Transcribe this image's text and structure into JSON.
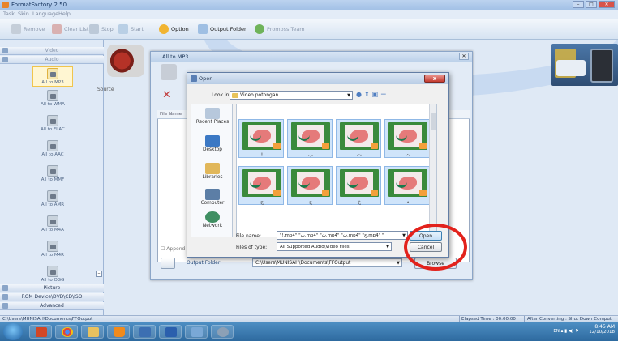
{
  "app": {
    "title": "FormatFactory 2.50"
  },
  "menu": [
    "Task",
    "Skin",
    "Language",
    "Help"
  ],
  "toolbar": {
    "remove": "Remove",
    "clear_list": "Clear List",
    "stop": "Stop",
    "start": "Start",
    "option": "Option",
    "output_folder": "Output Folder",
    "promo": "Promoss Team"
  },
  "sidebar": {
    "categories": {
      "video": "Video",
      "audio": "Audio",
      "picture": "Picture",
      "rom": "ROM Device\\DVD\\CD\\ISO",
      "advanced": "Advanced"
    },
    "formats": [
      "All to MP3",
      "All to WMA",
      "All to FLAC",
      "All to AAC",
      "All to MMF",
      "All to AMR",
      "All to M4A",
      "All to M4R",
      "All to OGG"
    ]
  },
  "mp3_dialog": {
    "title": "All to MP3",
    "source_label": "Source",
    "list_header": "File Name",
    "append_label": "Append",
    "output_folder_label": "Output Folder",
    "output_folder_value": "C:\\Users\\MUNISAH\\Documents\\FFOutput",
    "browse_label": "Browse"
  },
  "open_dialog": {
    "title": "Open",
    "close_label": "x",
    "look_in_label": "Look in:",
    "look_in_value": "Video potongan",
    "places": [
      "Recent Places",
      "Desktop",
      "Libraries",
      "Computer",
      "Network"
    ],
    "thumbnails": [
      {
        "label": "!",
        "letter": "ا"
      },
      {
        "label": "ب",
        "letter": "ب"
      },
      {
        "label": "ت",
        "letter": "ت"
      },
      {
        "label": "ث",
        "letter": "ث"
      },
      {
        "label": "ج",
        "letter": "ج"
      },
      {
        "label": "ح",
        "letter": "ح"
      },
      {
        "label": "خ",
        "letter": "خ"
      },
      {
        "label": "د",
        "letter": "د"
      }
    ],
    "file_name_label": "File name:",
    "file_name_value": "\"!.mp4\" \"ب.mp4\" \"ت.mp4\" \"ث.mp4\" \"ج.mp4\" \"",
    "files_of_type_label": "Files of type:",
    "files_of_type_value": "All Supported Audio\\Video Files",
    "open_label": "Open",
    "cancel_label": "Cancel"
  },
  "statusbar": {
    "path": "C:\\Users\\MUNISAH\\Documents\\FFOutput",
    "elapsed": "Elapsed Time : 00:00:00",
    "after": "After Converting : Shut Down Comput"
  },
  "taskbar": {
    "tray": "EN",
    "time": "8:45 AM",
    "date": "12/10/2018"
  },
  "colors": {
    "accent": "#2e6a9f",
    "highlight_circle": "#e2221c"
  }
}
